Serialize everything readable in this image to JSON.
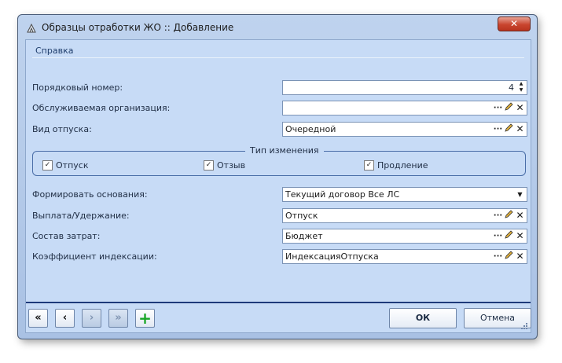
{
  "window": {
    "title": "Образцы отработки ЖО  :: Добавление",
    "close_label": "✕"
  },
  "menu": {
    "help_label": "Справка"
  },
  "form": {
    "order_number": {
      "label": "Порядковый номер:",
      "value": "4"
    },
    "organization": {
      "label": "Обслуживаемая организация:",
      "value": ""
    },
    "leave_type": {
      "label": "Вид отпуска:",
      "value": "Очередной"
    },
    "change_type": {
      "title": "Тип изменения",
      "options": [
        {
          "label": "Отпуск",
          "checked": true
        },
        {
          "label": "Отзыв",
          "checked": true
        },
        {
          "label": "Продление",
          "checked": true
        }
      ]
    },
    "basis": {
      "label": "Формировать основания:",
      "value": "Текущий договор Все ЛС"
    },
    "payment": {
      "label": "Выплата/Удержание:",
      "value": "Отпуск"
    },
    "costs": {
      "label": "Состав затрат:",
      "value": "Бюджет"
    },
    "index_coef": {
      "label": "Коэффициент индексации:",
      "value": "ИндексацияОтпуска"
    }
  },
  "buttons": {
    "first": "«",
    "prev": "‹",
    "next": "›",
    "last": "»",
    "add": "+",
    "ok": "ОК",
    "cancel": "Отмена"
  },
  "icons": {
    "ellipsis": "ellipsis-icon",
    "edit": "pencil-edit-icon",
    "clear": "close-icon"
  },
  "colors": {
    "window_bg": "#a9c1e4",
    "client_bg": "#c7dbf6",
    "accent_line": "#1d3a7a",
    "close_button": "#c9452f",
    "add_green": "#18a626"
  }
}
